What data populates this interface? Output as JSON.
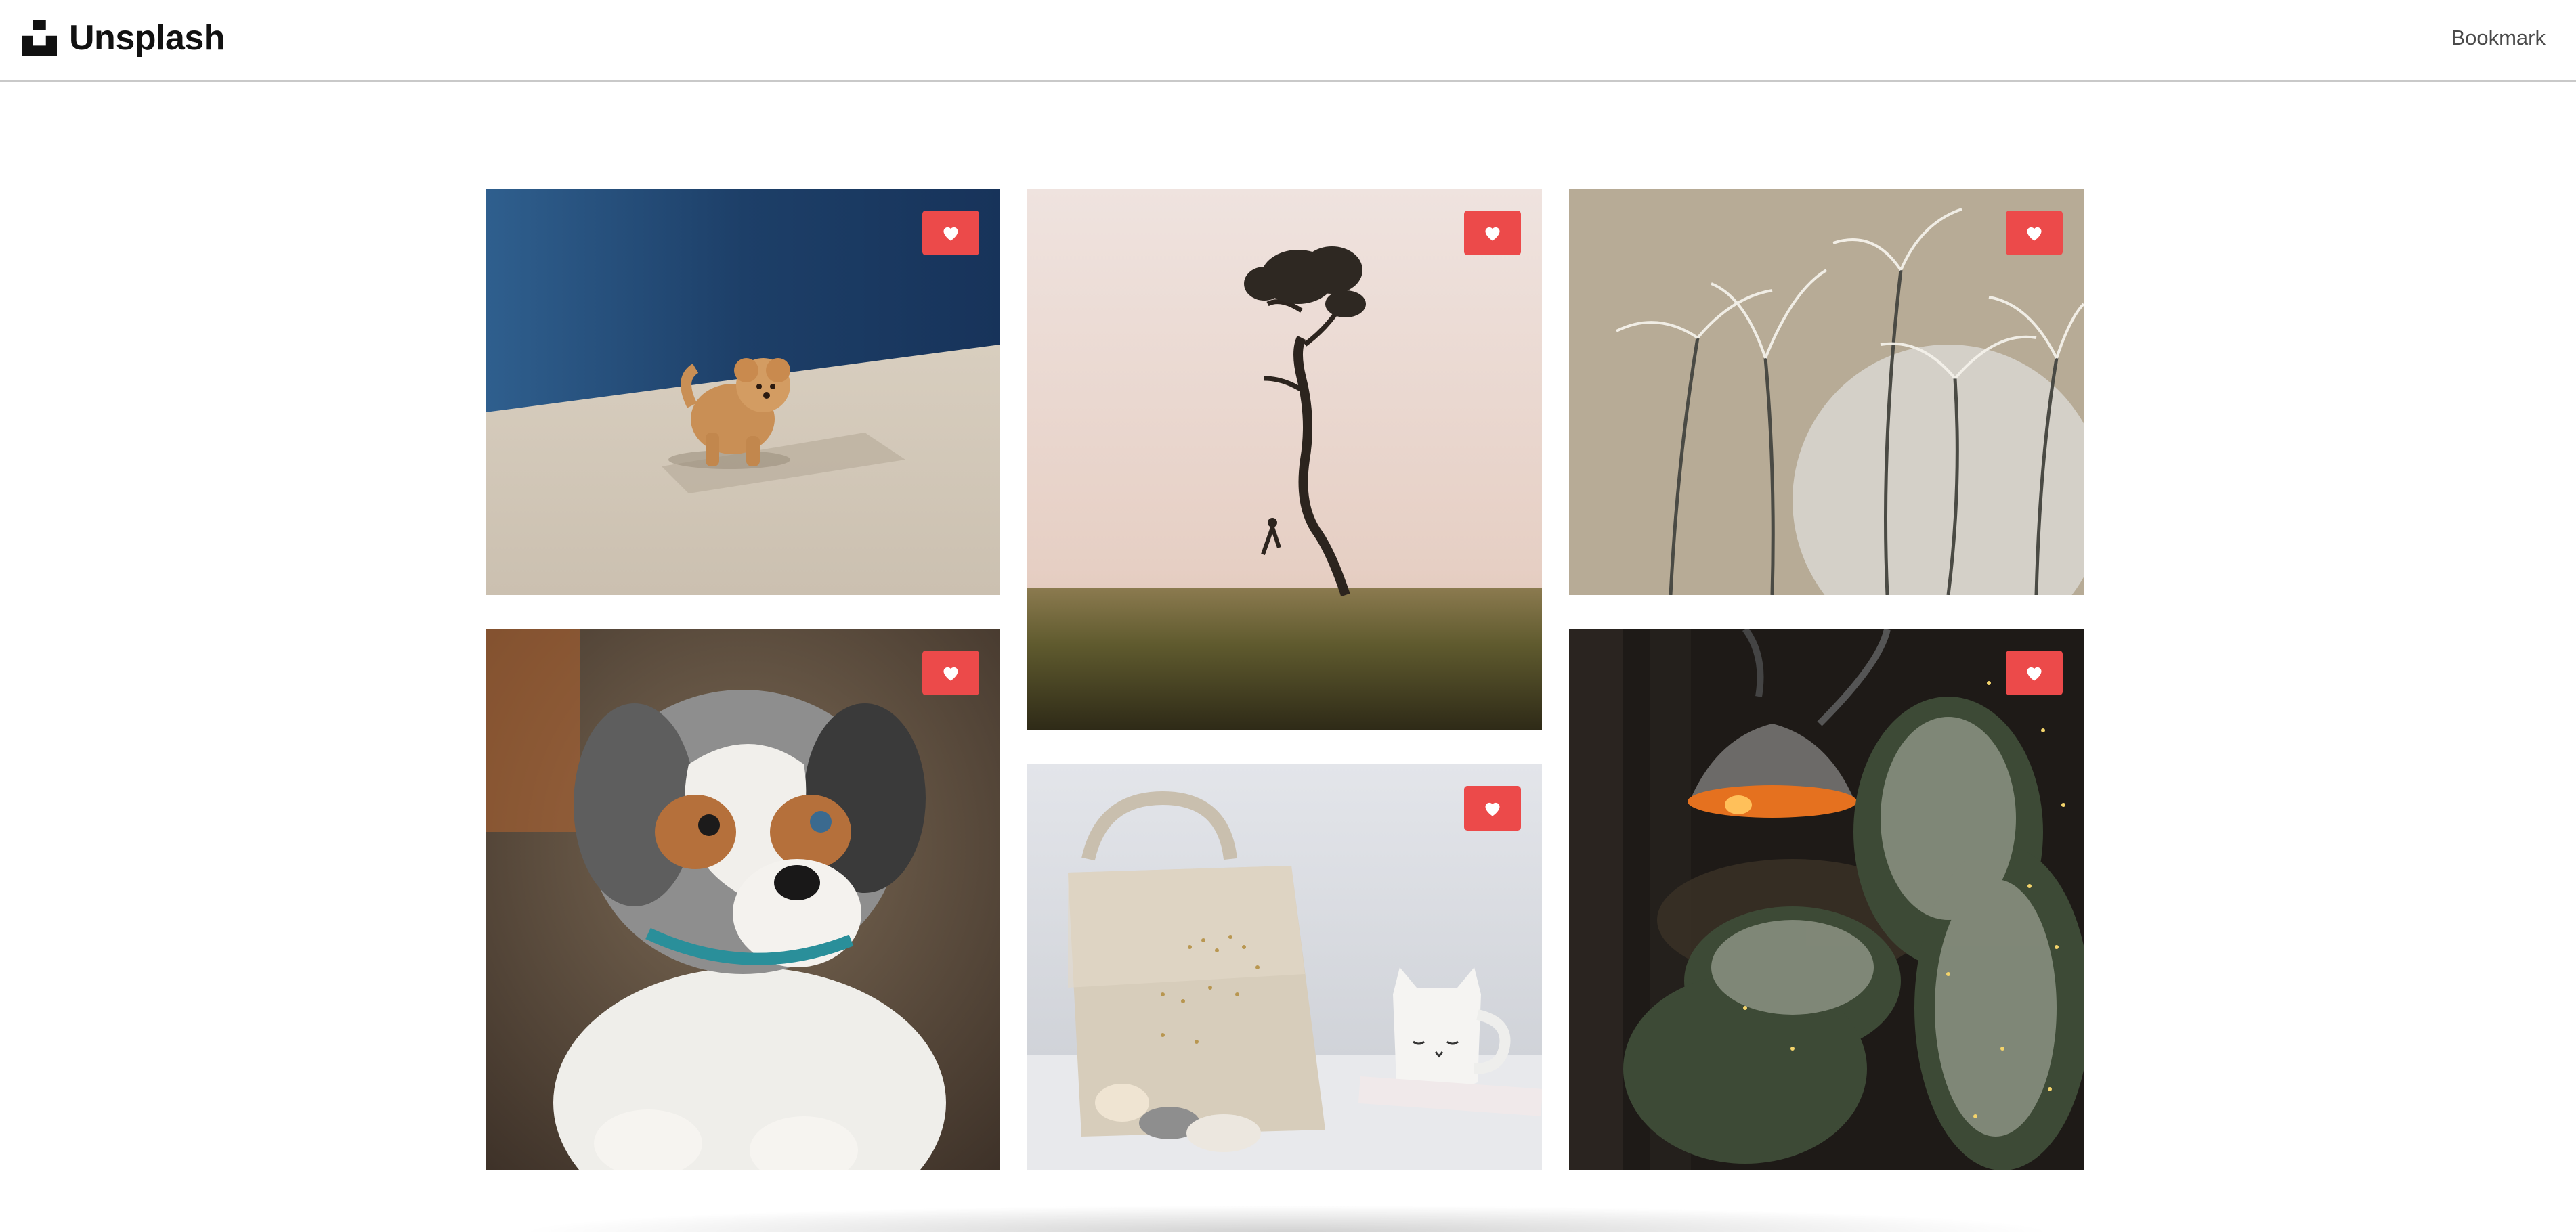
{
  "header": {
    "brand": "Unsplash",
    "nav_bookmark": "Bookmark"
  },
  "icons": {
    "logo": "unsplash-logo-icon",
    "like": "heart-icon"
  },
  "colors": {
    "like_button": "#ec4a4a",
    "header_border": "#c9c9c9",
    "background": "#ffffff"
  },
  "gallery": {
    "photos": [
      {
        "subject": "puppy-poodle",
        "like_icon": "heart-icon"
      },
      {
        "subject": "lone-tree-fog",
        "like_icon": "heart-icon"
      },
      {
        "subject": "pampas-grass",
        "like_icon": "heart-icon"
      },
      {
        "subject": "aussie-puppy",
        "like_icon": "heart-icon"
      },
      {
        "subject": "tote-bag-mug",
        "like_icon": "heart-icon"
      },
      {
        "subject": "lamp-pine",
        "like_icon": "heart-icon"
      }
    ]
  }
}
